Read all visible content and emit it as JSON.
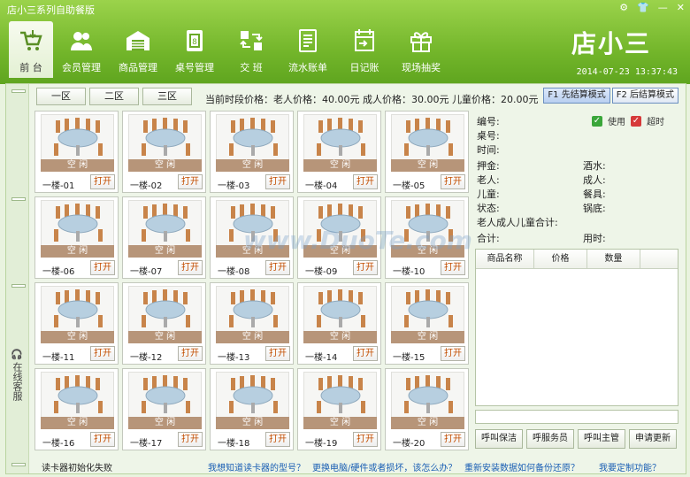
{
  "window": {
    "title": "店小三系列自助餐版",
    "controls": [
      "gear-icon",
      "shirt-icon",
      "minimize",
      "close"
    ]
  },
  "toolbar": {
    "items": [
      {
        "label": "前 台",
        "icon": "cart-icon",
        "active": true
      },
      {
        "label": "会员管理",
        "icon": "users-icon"
      },
      {
        "label": "商品管理",
        "icon": "warehouse-icon"
      },
      {
        "label": "桌号管理",
        "icon": "table-number-icon"
      },
      {
        "label": "交 班",
        "icon": "handover-icon"
      },
      {
        "label": "流水账单",
        "icon": "ledger-icon"
      },
      {
        "label": "日记账",
        "icon": "journal-icon"
      },
      {
        "label": "现场抽奖",
        "icon": "gift-icon"
      }
    ]
  },
  "brand": {
    "logo": "店小三",
    "datetime": "2014-07-23 13:37:43"
  },
  "zones": [
    "一区",
    "二区",
    "三区"
  ],
  "prices": {
    "text": "当前时段价格：老人价格：40.00元   成人价格：30.00元   儿童价格：20.00元"
  },
  "modes": [
    "F1 先结算模式",
    "F2 后结算模式"
  ],
  "tables": [
    {
      "name": "一楼-01",
      "status": "空 闲",
      "action": "打开"
    },
    {
      "name": "一楼-02",
      "status": "空 闲",
      "action": "打开"
    },
    {
      "name": "一楼-03",
      "status": "空 闲",
      "action": "打开"
    },
    {
      "name": "一楼-04",
      "status": "空 闲",
      "action": "打开"
    },
    {
      "name": "一楼-05",
      "status": "空 闲",
      "action": "打开"
    },
    {
      "name": "一楼-06",
      "status": "空 闲",
      "action": "打开"
    },
    {
      "name": "一楼-07",
      "status": "空 闲",
      "action": "打开"
    },
    {
      "name": "一楼-08",
      "status": "空 闲",
      "action": "打开"
    },
    {
      "name": "一楼-09",
      "status": "空 闲",
      "action": "打开"
    },
    {
      "name": "一楼-10",
      "status": "空 闲",
      "action": "打开"
    },
    {
      "name": "一楼-11",
      "status": "空 闲",
      "action": "打开"
    },
    {
      "name": "一楼-12",
      "status": "空 闲",
      "action": "打开"
    },
    {
      "name": "一楼-13",
      "status": "空 闲",
      "action": "打开"
    },
    {
      "name": "一楼-14",
      "status": "空 闲",
      "action": "打开"
    },
    {
      "name": "一楼-15",
      "status": "空 闲",
      "action": "打开"
    },
    {
      "name": "一楼-16",
      "status": "空 闲",
      "action": "打开"
    },
    {
      "name": "一楼-17",
      "status": "空 闲",
      "action": "打开"
    },
    {
      "name": "一楼-18",
      "status": "空 闲",
      "action": "打开"
    },
    {
      "name": "一楼-19",
      "status": "空 闲",
      "action": "打开"
    },
    {
      "name": "一楼-20",
      "status": "空 闲",
      "action": "打开"
    }
  ],
  "detail": {
    "legend_use": "使用",
    "legend_over": "超时",
    "bianhao": "编号:",
    "zhuohao": "桌号:",
    "shijian": "时间:",
    "yajin": "押金:",
    "jiushui": "酒水:",
    "laoren": "老人:",
    "chengren": "成人:",
    "ertong": "儿童:",
    "canju": "餐具:",
    "zhuangtai": "状态:",
    "guodi": "锅底:",
    "heji3": "老人成人儿童合计:",
    "heji": "合计:",
    "yongshi": "用时:"
  },
  "goods": {
    "headers": [
      "商品名称",
      "价格",
      "数量"
    ]
  },
  "actions": [
    "呼叫保洁",
    "呼服务员",
    "呼叫主管",
    "申请更新"
  ],
  "sidebar": {
    "support": "在线客服"
  },
  "status": {
    "left": "读卡器初始化失败",
    "links": [
      "我想知道读卡器的型号？",
      "更换电脑/硬件或者损坏，该怎么办？",
      "重新安装数据如何备份还原？",
      "我要定制功能？"
    ]
  },
  "watermark": "www.DuoTe.com",
  "colors": {
    "accent": "#72b52a",
    "status_bar": "#b79579",
    "open_text": "#c24d00"
  }
}
